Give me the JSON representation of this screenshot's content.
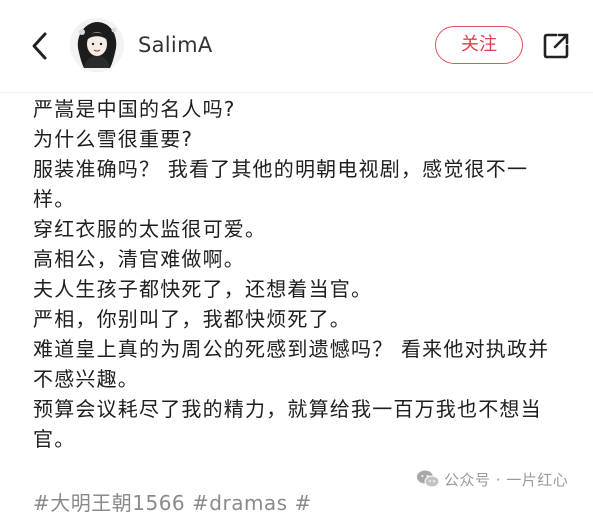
{
  "header": {
    "username": "SalimA",
    "follow_label": "关注",
    "back_icon": "chevron-left-icon",
    "share_icon": "share-icon",
    "accent_color": "#e23d4a"
  },
  "post": {
    "lines": [
      "严嵩是中国的名人吗?",
      "为什么雪很重要?",
      "服装准确吗？ 我看了其他的明朝电视剧，感觉很不一样。",
      "穿红衣服的太监很可爱。",
      "高相公，清官难做啊。",
      "夫人生孩子都快死了，还想着当官。",
      "严相，你别叫了，我都快烦死了。",
      "难道皇上真的为周公的死感到遗憾吗？ 看来他对执政并不感兴趣。",
      "预算会议耗尽了我的精力，就算给我一百万我也不想当官。"
    ],
    "hashtags": "#大明王朝1566 #dramas #"
  },
  "watermark": {
    "text": "公众号 · 一片红心",
    "icon": "wechat-icon"
  }
}
